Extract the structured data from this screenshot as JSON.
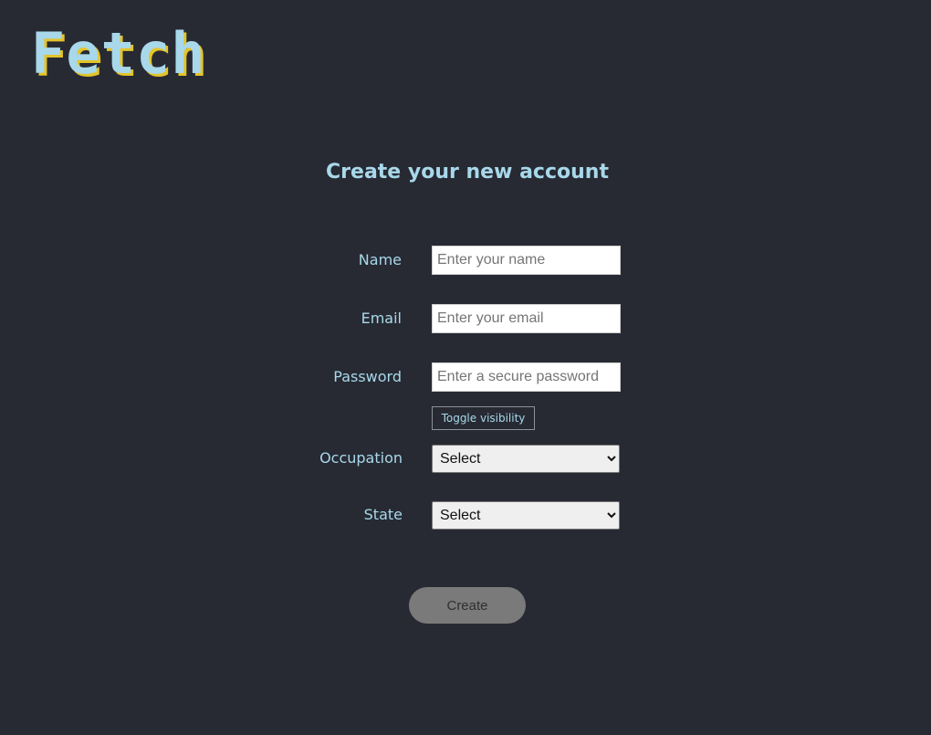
{
  "header": {
    "logo_text": "Fetch"
  },
  "form": {
    "title": "Create your new account",
    "name": {
      "label": "Name",
      "placeholder": "Enter your name",
      "value": ""
    },
    "email": {
      "label": "Email",
      "placeholder": "Enter your email",
      "value": ""
    },
    "password": {
      "label": "Password",
      "placeholder": "Enter a secure password",
      "value": ""
    },
    "toggle_visibility_label": "Toggle visibility",
    "occupation": {
      "label": "Occupation",
      "selected": "Select"
    },
    "state": {
      "label": "State",
      "selected": "Select"
    },
    "create_label": "Create"
  },
  "colors": {
    "background": "#272a33",
    "accent": "#a8d8ea",
    "logo_shadow": "#e3c42a",
    "create_button_bg": "#7a7a7a"
  }
}
